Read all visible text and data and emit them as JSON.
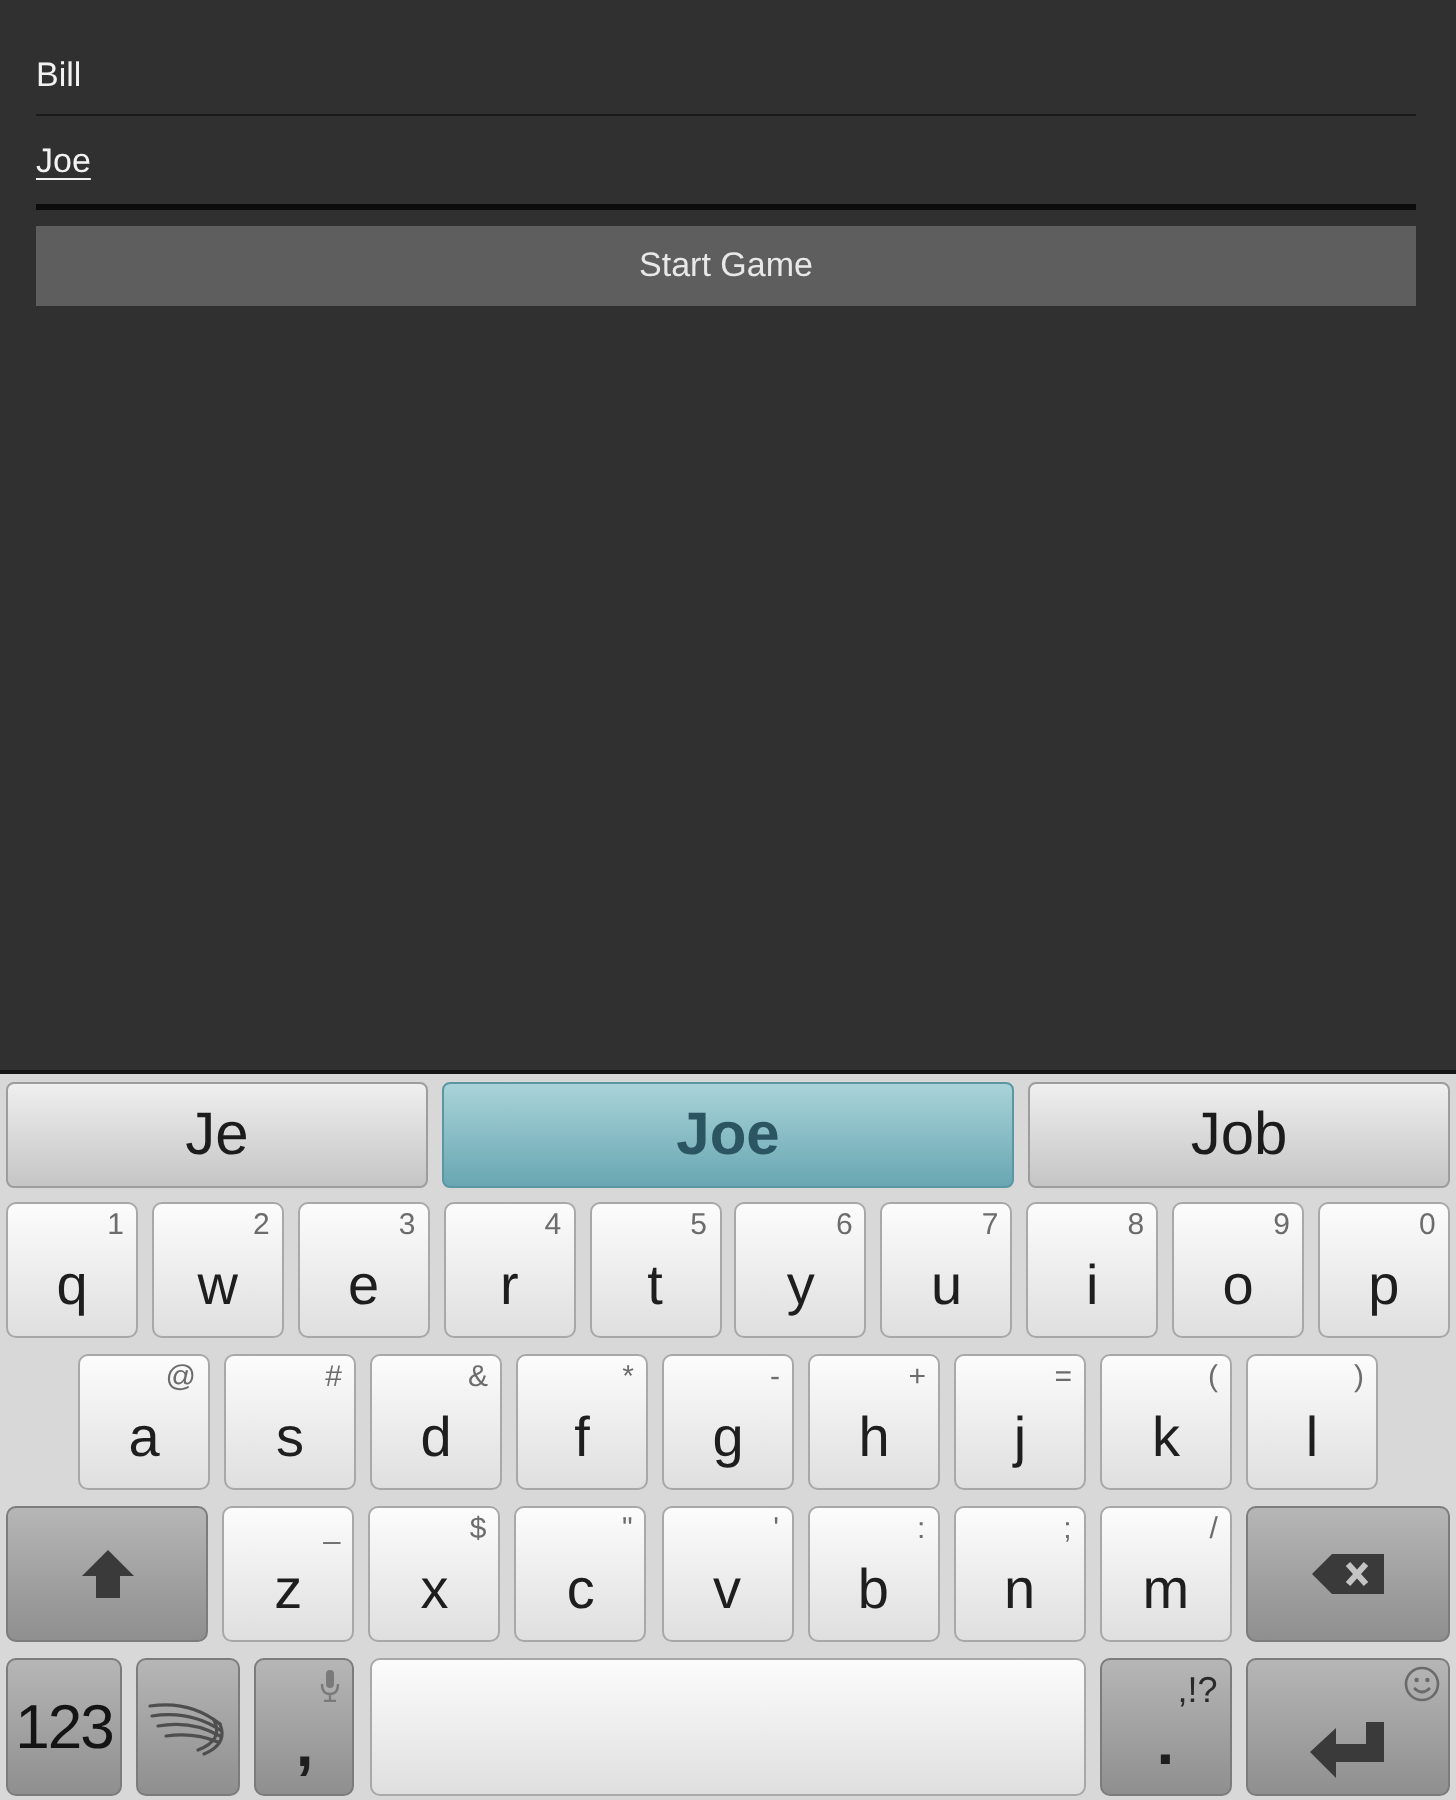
{
  "form": {
    "fields": [
      {
        "value": "Bill",
        "focused": false,
        "composing": false
      },
      {
        "value": "Joe",
        "focused": true,
        "composing": true
      }
    ],
    "button": "Start Game"
  },
  "keyboard": {
    "suggestions": [
      {
        "text": "Je",
        "selected": false
      },
      {
        "text": "Joe",
        "selected": true
      },
      {
        "text": "Job",
        "selected": false
      }
    ],
    "rows": [
      {
        "keys": [
          {
            "kind": "letter",
            "label": "q",
            "hint": "1"
          },
          {
            "kind": "letter",
            "label": "w",
            "hint": "2"
          },
          {
            "kind": "letter",
            "label": "e",
            "hint": "3"
          },
          {
            "kind": "letter",
            "label": "r",
            "hint": "4"
          },
          {
            "kind": "letter",
            "label": "t",
            "hint": "5"
          },
          {
            "kind": "letter",
            "label": "y",
            "hint": "6"
          },
          {
            "kind": "letter",
            "label": "u",
            "hint": "7"
          },
          {
            "kind": "letter",
            "label": "i",
            "hint": "8"
          },
          {
            "kind": "letter",
            "label": "o",
            "hint": "9"
          },
          {
            "kind": "letter",
            "label": "p",
            "hint": "0"
          }
        ]
      },
      {
        "keys": [
          {
            "kind": "letter",
            "label": "a",
            "hint": "@"
          },
          {
            "kind": "letter",
            "label": "s",
            "hint": "#"
          },
          {
            "kind": "letter",
            "label": "d",
            "hint": "&"
          },
          {
            "kind": "letter",
            "label": "f",
            "hint": "*"
          },
          {
            "kind": "letter",
            "label": "g",
            "hint": "-"
          },
          {
            "kind": "letter",
            "label": "h",
            "hint": "+"
          },
          {
            "kind": "letter",
            "label": "j",
            "hint": "="
          },
          {
            "kind": "letter",
            "label": "k",
            "hint": "("
          },
          {
            "kind": "letter",
            "label": "l",
            "hint": ")"
          }
        ]
      },
      {
        "keys": [
          {
            "kind": "shift"
          },
          {
            "kind": "letter",
            "label": "z",
            "hint": "_"
          },
          {
            "kind": "letter",
            "label": "x",
            "hint": "$"
          },
          {
            "kind": "letter",
            "label": "c",
            "hint": "\""
          },
          {
            "kind": "letter",
            "label": "v",
            "hint": "'"
          },
          {
            "kind": "letter",
            "label": "b",
            "hint": ":"
          },
          {
            "kind": "letter",
            "label": "n",
            "hint": ";"
          },
          {
            "kind": "letter",
            "label": "m",
            "hint": "/"
          },
          {
            "kind": "backspace"
          }
        ]
      },
      {
        "keys": [
          {
            "kind": "mode",
            "label": "123"
          },
          {
            "kind": "emblem"
          },
          {
            "kind": "comma",
            "label": ","
          },
          {
            "kind": "space"
          },
          {
            "kind": "period",
            "label": ".",
            "hint": ",!?"
          },
          {
            "kind": "enter"
          }
        ]
      }
    ]
  }
}
